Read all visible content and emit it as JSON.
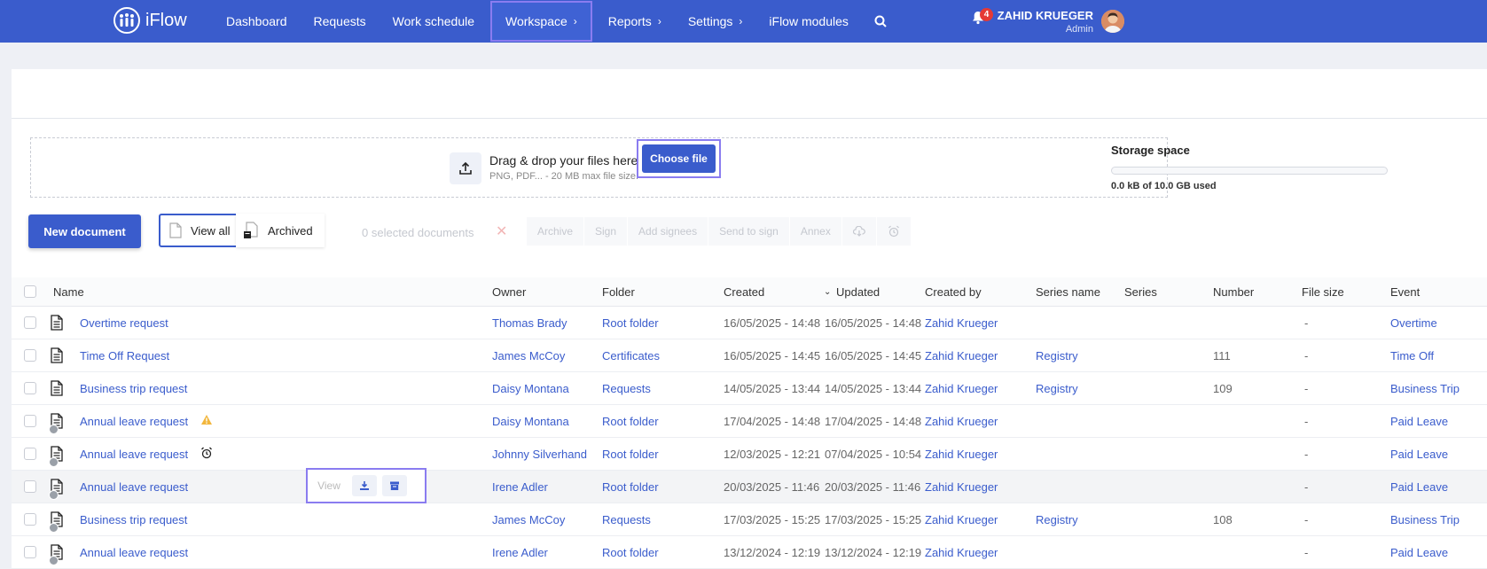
{
  "app": {
    "brand": "iFlow"
  },
  "nav": [
    {
      "label": "Dashboard",
      "chevron": false
    },
    {
      "label": "Requests",
      "chevron": false
    },
    {
      "label": "Work schedule",
      "chevron": false
    },
    {
      "label": "Workspace",
      "chevron": true,
      "active": true
    },
    {
      "label": "Reports",
      "chevron": true
    },
    {
      "label": "Settings",
      "chevron": true
    },
    {
      "label": "iFlow modules",
      "chevron": false
    }
  ],
  "notifications": {
    "count": "4"
  },
  "user": {
    "name": "ZAHID KRUEGER",
    "role": "Admin"
  },
  "upload": {
    "title": "Drag & drop your files here",
    "subtitle": "PNG, PDF... - 20 MB max file size.",
    "button": "Choose file"
  },
  "storage": {
    "title": "Storage space",
    "used_text": "0.0 kB of 10.0 GB used",
    "used_fraction": 0
  },
  "toolbar": {
    "new_document": "New document",
    "view_all": "View all",
    "archived": "Archived",
    "selected": "0 selected documents",
    "actions": [
      "Archive",
      "Sign",
      "Add signees",
      "Send to sign",
      "Annex"
    ]
  },
  "table": {
    "columns": [
      "Name",
      "Owner",
      "Folder",
      "Created",
      "Updated",
      "Created by",
      "Series name",
      "Series",
      "Number",
      "File size",
      "Event"
    ],
    "rows": [
      {
        "name": "Overtime request",
        "owner": "Thomas Brady",
        "folder": "Root folder",
        "created": "16/05/2025 - 14:48",
        "updated": "16/05/2025 - 14:48",
        "created_by": "Zahid Krueger",
        "series_name": "",
        "number": "",
        "file_size": "-",
        "event": "Overtime",
        "marker": ""
      },
      {
        "name": "Time Off Request",
        "owner": "James McCoy",
        "folder": "Certificates",
        "created": "16/05/2025 - 14:45",
        "updated": "16/05/2025 - 14:45",
        "created_by": "Zahid Krueger",
        "series_name": "Registry",
        "number": "111",
        "file_size": "-",
        "event": "Time Off",
        "marker": ""
      },
      {
        "name": "Business trip request",
        "owner": "Daisy Montana",
        "folder": "Requests",
        "created": "14/05/2025 - 13:44",
        "updated": "14/05/2025 - 13:44",
        "created_by": "Zahid Krueger",
        "series_name": "Registry",
        "number": "109",
        "file_size": "-",
        "event": "Business Trip",
        "marker": ""
      },
      {
        "name": "Annual leave request",
        "owner": "Daisy Montana",
        "folder": "Root folder",
        "created": "17/04/2025 - 14:48",
        "updated": "17/04/2025 - 14:48",
        "created_by": "Zahid Krueger",
        "series_name": "",
        "number": "",
        "file_size": "-",
        "event": "Paid Leave",
        "marker": "warning"
      },
      {
        "name": "Annual leave request",
        "owner": "Johnny Silverhand",
        "folder": "Root folder",
        "created": "12/03/2025 - 12:21",
        "updated": "07/04/2025 - 10:54",
        "created_by": "Zahid Krueger",
        "series_name": "",
        "number": "",
        "file_size": "-",
        "event": "Paid Leave",
        "marker": "alarm"
      },
      {
        "name": "Annual leave request",
        "owner": "Irene Adler",
        "folder": "Root folder",
        "created": "20/03/2025 - 11:46",
        "updated": "20/03/2025 - 11:46",
        "created_by": "Zahid Krueger",
        "series_name": "",
        "number": "",
        "file_size": "-",
        "event": "Paid Leave",
        "marker": ""
      },
      {
        "name": "Business trip request",
        "owner": "James McCoy",
        "folder": "Requests",
        "created": "17/03/2025 - 15:25",
        "updated": "17/03/2025 - 15:25",
        "created_by": "Zahid Krueger",
        "series_name": "Registry",
        "number": "108",
        "file_size": "-",
        "event": "Business Trip",
        "marker": ""
      },
      {
        "name": "Annual leave request",
        "owner": "Irene Adler",
        "folder": "Root folder",
        "created": "13/12/2024 - 12:19",
        "updated": "13/12/2024 - 12:19",
        "created_by": "Zahid Krueger",
        "series_name": "",
        "number": "",
        "file_size": "-",
        "event": "Paid Leave",
        "marker": ""
      }
    ]
  },
  "row_actions": {
    "view": "View"
  }
}
